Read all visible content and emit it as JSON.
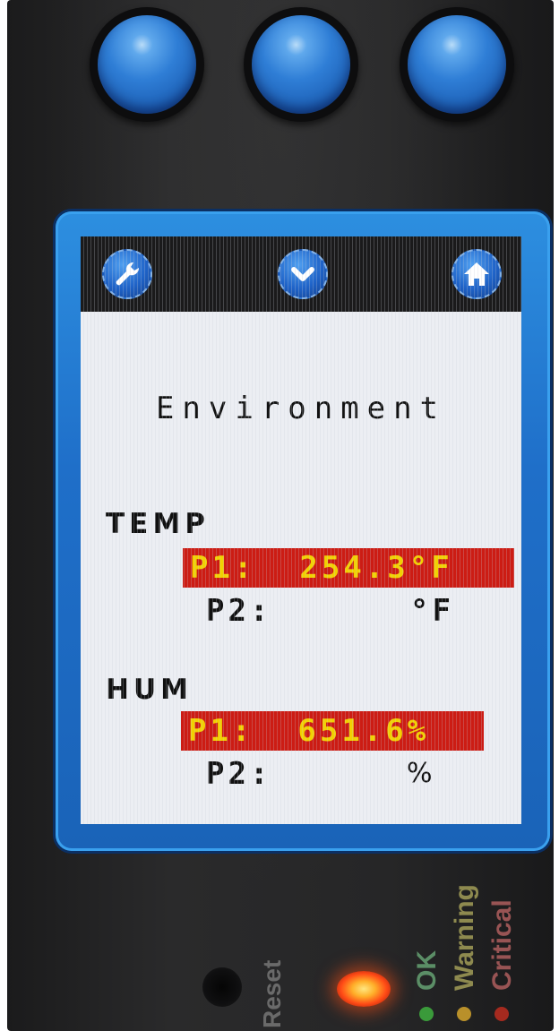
{
  "screen": {
    "title": "Environment",
    "nav": {
      "left_icon": "wrench-icon",
      "center_icon": "chevron-down-icon",
      "right_icon": "home-icon"
    },
    "temp": {
      "label": "TEMP",
      "p1_label": "P1:",
      "p1_value": "254.3°F",
      "p2_label": "P2:",
      "p2_unit": "°F"
    },
    "hum": {
      "label": "HUM",
      "p1_label": "P1:",
      "p1_value": "651.6%",
      "p2_label": "P2:",
      "p2_unit": "%"
    }
  },
  "status_panel": {
    "reset_label": "Reset",
    "ok_label": "OK",
    "warning_label": "Warning",
    "critical_label": "Critical"
  },
  "colors": {
    "alarm_background": "#cc1c14",
    "alarm_text": "#f2d100",
    "bezel": "#1f6fc9",
    "button_blue": "#2f7ed6"
  }
}
